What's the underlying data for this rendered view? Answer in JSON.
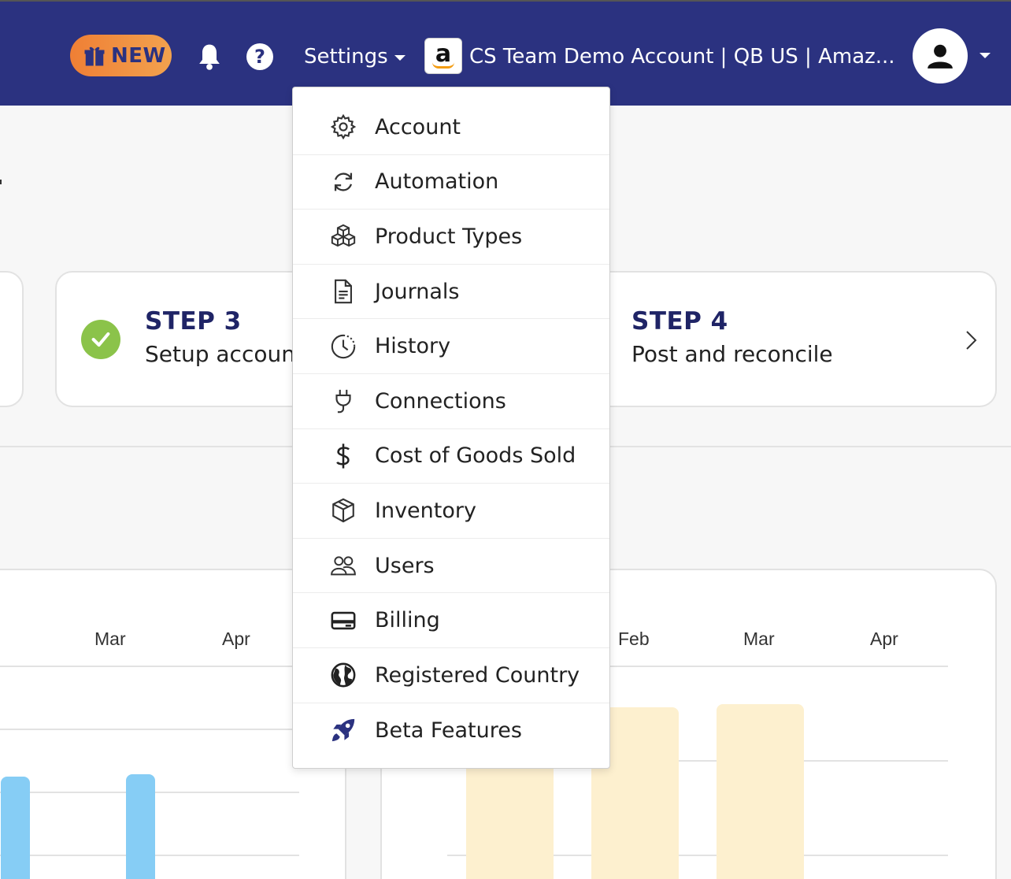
{
  "header": {
    "new_label": "NEW",
    "help_symbol": "?",
    "settings_label": "Settings",
    "amazon_logo_letter": "a",
    "account_name": "CS Team Demo Account | QB US | Amaz...",
    "bar_color": "#2b3280",
    "new_gradient": [
      "#ef7f35",
      "#f2a24e"
    ]
  },
  "steps": [
    {
      "title": "STEP 3",
      "subtitle": "Setup account",
      "status": "complete"
    },
    {
      "title": "STEP 4",
      "subtitle": "Post and reconcile"
    }
  ],
  "settings_menu": {
    "items": [
      {
        "label": "Account",
        "icon": "gear-icon"
      },
      {
        "label": "Automation",
        "icon": "sync-icon"
      },
      {
        "label": "Product Types",
        "icon": "boxes-icon"
      },
      {
        "label": "Journals",
        "icon": "document-icon"
      },
      {
        "label": "History",
        "icon": "clock-icon"
      },
      {
        "label": "Connections",
        "icon": "plug-icon"
      },
      {
        "label": "Cost of Goods Sold",
        "icon": "dollar-icon"
      },
      {
        "label": "Inventory",
        "icon": "package-icon"
      },
      {
        "label": "Users",
        "icon": "users-icon"
      },
      {
        "label": "Billing",
        "icon": "credit-card-icon"
      },
      {
        "label": "Registered Country",
        "icon": "globe-icon"
      },
      {
        "label": "Beta Features",
        "icon": "rocket-icon"
      }
    ]
  },
  "charts": {
    "left_ticks": [
      "Mar",
      "Apr"
    ],
    "right_ticks": [
      "Feb",
      "Mar",
      "Apr"
    ],
    "blue_color": "#86cdf5",
    "yellow_color": "#fdf0cf"
  }
}
